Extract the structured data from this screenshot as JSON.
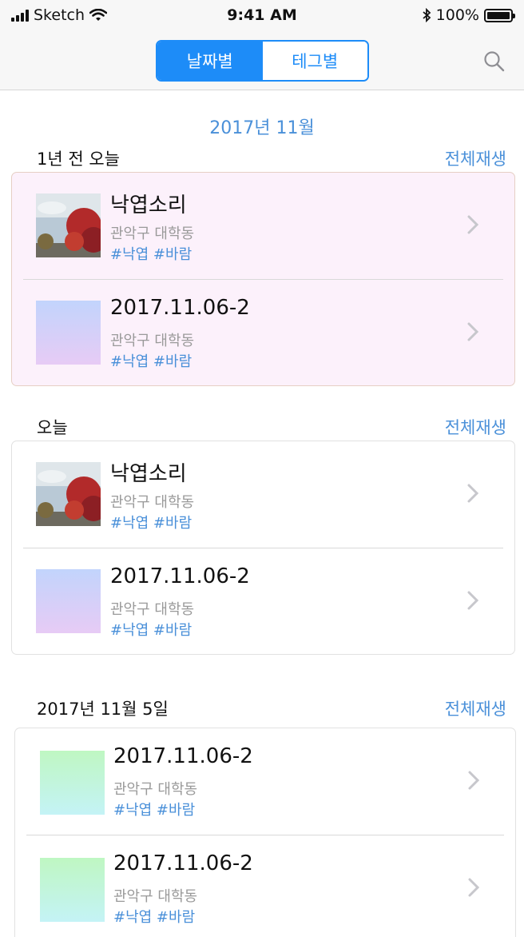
{
  "status_bar": {
    "carrier": "Sketch",
    "time": "9:41 AM",
    "battery": "100%"
  },
  "nav": {
    "segments": [
      {
        "label": "날짜별",
        "active": true
      },
      {
        "label": "테그별",
        "active": false
      }
    ]
  },
  "month_label": "2017년  11월",
  "sections": [
    {
      "title": "1년 전 오늘",
      "play_all": "전체재생",
      "items": [
        {
          "name": "낙엽소리",
          "location": "관악구 대학동",
          "tags": "#낙엽 #바람",
          "thumb": "photo"
        },
        {
          "name": "2017.11.06-2",
          "location": "관악구 대학동",
          "tags": "#낙엽 #바람",
          "thumb": "gradient-blue"
        }
      ]
    },
    {
      "title": "오늘",
      "play_all": "전체재생",
      "items": [
        {
          "name": "낙엽소리",
          "location": "관악구 대학동",
          "tags": "#낙엽 #바람",
          "thumb": "photo"
        },
        {
          "name": "2017.11.06-2",
          "location": "관악구 대학동",
          "tags": "#낙엽 #바람",
          "thumb": "gradient-blue"
        }
      ]
    },
    {
      "title": "2017년 11월 5일",
      "play_all": "전체재생",
      "items": [
        {
          "name": "2017.11.06-2",
          "location": "관악구 대학동",
          "tags": "#낙엽 #바람",
          "thumb": "gradient-green"
        },
        {
          "name": "2017.11.06-2",
          "location": "관악구 대학동",
          "tags": "#낙엽 #바람",
          "thumb": "gradient-green"
        }
      ]
    }
  ],
  "colors": {
    "accent": "#1d8cf8",
    "link": "#4a90d9",
    "highlight_bg": "#fcf1fb"
  },
  "icons": {
    "search": "search-icon",
    "chevron": "chevron-right-icon",
    "signal": "signal-icon",
    "wifi": "wifi-icon",
    "bluetooth": "bluetooth-icon",
    "battery": "battery-icon"
  }
}
